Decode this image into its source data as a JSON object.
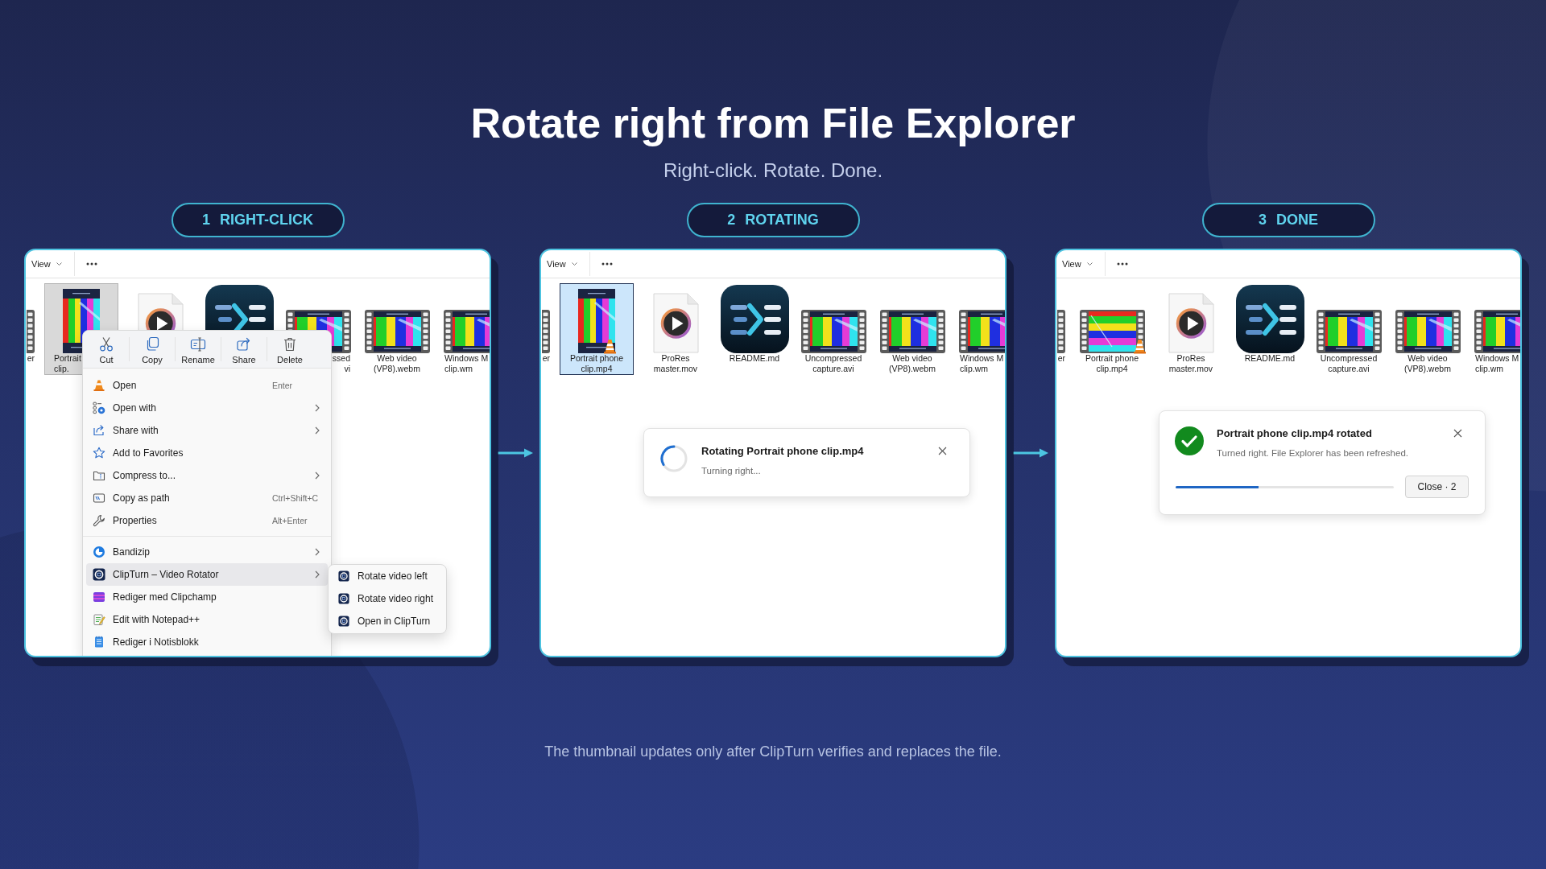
{
  "header": {
    "title": "Rotate right from File Explorer",
    "subtitle": "Right-click. Rotate. Done."
  },
  "steps": [
    {
      "number": "1",
      "title": "RIGHT-CLICK",
      "explorer": {
        "view": "View",
        "files": [
          {
            "kind": "video",
            "label": [
              "er"
            ],
            "cut_left": true,
            "at_edge": true,
            "selected": false
          },
          {
            "kind": "portrait-video",
            "label": [
              "Portrait",
              "clip."
            ],
            "cut_right": true,
            "selected": true
          },
          {
            "kind": "document",
            "selected": false
          },
          {
            "kind": "app",
            "selected": false
          },
          {
            "kind": "video",
            "label": [
              "ssed",
              "vi"
            ],
            "cut_left": true,
            "selected": false
          },
          {
            "kind": "video",
            "label": [
              "Web video",
              "(VP8).webm"
            ],
            "selected": false
          },
          {
            "kind": "video",
            "label": [
              "Windows M",
              "clip.wm"
            ],
            "cut_right": true,
            "at_edge": true,
            "selected": false
          }
        ],
        "context_menu": {
          "actions": [
            "Cut",
            "Copy",
            "Rename",
            "Share",
            "Delete"
          ],
          "groups": [
            {
              "items": [
                {
                  "label": "Open",
                  "shortcut": "Enter",
                  "has_submenu": false,
                  "selected": false
                },
                {
                  "label": "Open with",
                  "has_submenu": true,
                  "selected": false
                },
                {
                  "label": "Share with",
                  "has_submenu": true,
                  "selected": false
                },
                {
                  "label": "Add to Favorites",
                  "has_submenu": false,
                  "selected": false
                },
                {
                  "label": "Compress to...",
                  "has_submenu": true,
                  "selected": false
                },
                {
                  "label": "Copy as path",
                  "shortcut": "Ctrl+Shift+C",
                  "has_submenu": false,
                  "selected": false
                },
                {
                  "label": "Properties",
                  "shortcut": "Alt+Enter",
                  "has_submenu": false,
                  "selected": false
                }
              ]
            },
            {
              "items": [
                {
                  "label": "Bandizip",
                  "has_submenu": true,
                  "selected": false
                },
                {
                  "label": "ClipTurn – Video Rotator",
                  "has_submenu": true,
                  "selected": true
                },
                {
                  "label": "Rediger med Clipchamp",
                  "has_submenu": false,
                  "selected": false
                },
                {
                  "label": "Edit with Notepad++",
                  "has_submenu": false,
                  "selected": false
                },
                {
                  "label": "Rediger i Notisblokk",
                  "has_submenu": false,
                  "selected": false
                }
              ]
            }
          ],
          "submenu": {
            "items": [
              "Rotate video left",
              "Rotate video right",
              "Open in ClipTurn"
            ]
          }
        }
      }
    },
    {
      "number": "2",
      "title": "ROTATING",
      "explorer": {
        "view": "View",
        "files": [
          {
            "kind": "video",
            "label": [
              "er"
            ],
            "cut_left": true,
            "at_edge": true,
            "selected": false
          },
          {
            "kind": "portrait-video",
            "label": [
              "Portrait phone",
              "clip.mp4"
            ],
            "cone_badge": true,
            "selected": true
          },
          {
            "kind": "document",
            "label": [
              "ProRes",
              "master.mov"
            ],
            "selected": false
          },
          {
            "kind": "app",
            "label": [
              "README.md"
            ],
            "selected": false
          },
          {
            "kind": "video",
            "label": [
              "Uncompressed",
              "capture.avi"
            ],
            "selected": false
          },
          {
            "kind": "video",
            "label": [
              "Web video",
              "(VP8).webm"
            ],
            "selected": false
          },
          {
            "kind": "video",
            "label": [
              "Windows M",
              "clip.wm"
            ],
            "cut_right": true,
            "at_edge": true,
            "selected": false
          }
        ],
        "toast": {
          "kind": "progress",
          "title": "Rotating Portrait phone clip.mp4",
          "message": "Turning right..."
        }
      }
    },
    {
      "number": "3",
      "title": "DONE",
      "explorer": {
        "view": "View",
        "files": [
          {
            "kind": "video",
            "label": [
              "er"
            ],
            "cut_left": true,
            "at_edge": true,
            "selected": false
          },
          {
            "kind": "landscape-video",
            "label": [
              "Portrait phone",
              "clip.mp4"
            ],
            "cone_badge": true,
            "selected": false
          },
          {
            "kind": "document",
            "label": [
              "ProRes",
              "master.mov"
            ],
            "selected": false
          },
          {
            "kind": "app",
            "label": [
              "README.md"
            ],
            "selected": false
          },
          {
            "kind": "video",
            "label": [
              "Uncompressed",
              "capture.avi"
            ],
            "selected": false
          },
          {
            "kind": "video",
            "label": [
              "Web video",
              "(VP8).webm"
            ],
            "selected": false
          },
          {
            "kind": "video",
            "label": [
              "Windows M",
              "clip.wm"
            ],
            "cut_right": true,
            "at_edge": true,
            "selected": false
          }
        ],
        "toast": {
          "kind": "success",
          "title": "Portrait phone clip.mp4 rotated",
          "message": "Turned right. File Explorer has been refreshed.",
          "level": 0.38,
          "button": "Close · 2"
        }
      }
    }
  ],
  "footnote": "The thumbnail updates only after ClipTurn verifies and replaces the file."
}
